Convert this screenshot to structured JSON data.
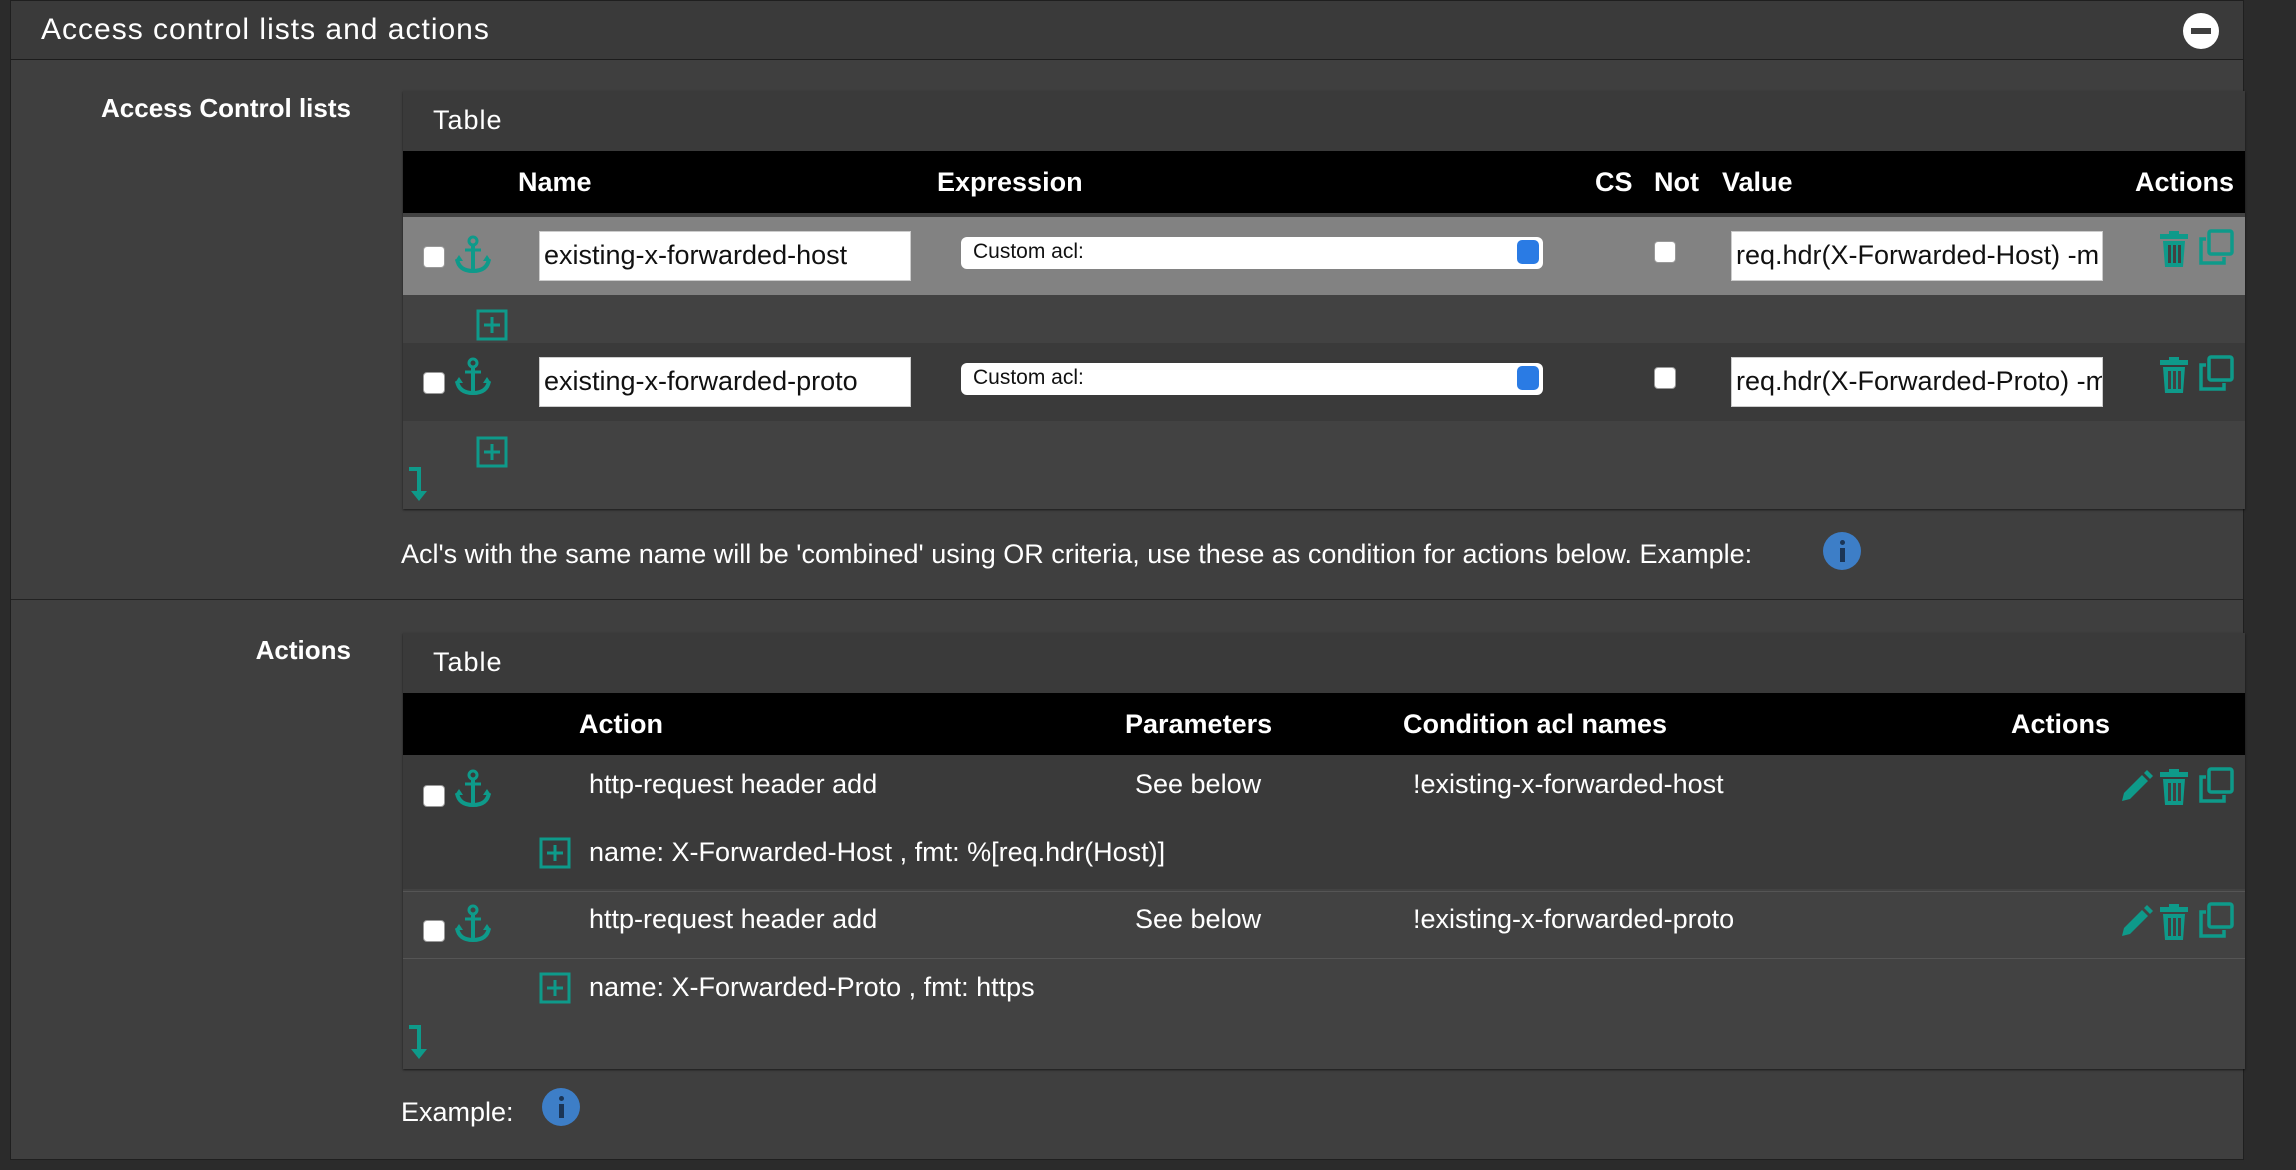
{
  "panel": {
    "title": "Access control lists and actions"
  },
  "acl": {
    "label": "Access Control lists",
    "table_caption": "Table",
    "columns": [
      "Name",
      "Expression",
      "CS",
      "Not",
      "Value",
      "Actions"
    ],
    "rows": [
      {
        "name": "existing-x-forwarded-host",
        "expression": "Custom acl:",
        "value": "req.hdr(X-Forwarded-Host) -m"
      },
      {
        "name": "existing-x-forwarded-proto",
        "expression": "Custom acl:",
        "value": "req.hdr(X-Forwarded-Proto) -m"
      }
    ],
    "note": "Acl's with the same name will be 'combined' using OR criteria, use these as condition for actions below. Example:"
  },
  "actions": {
    "label": "Actions",
    "table_caption": "Table",
    "columns": [
      "Action",
      "Parameters",
      "Condition acl names",
      "Actions"
    ],
    "rows": [
      {
        "action": "http-request header add",
        "parameters": "See below",
        "condition": "!existing-x-forwarded-host",
        "detail": "name: X-Forwarded-Host , fmt: %[req.hdr(Host)]"
      },
      {
        "action": "http-request header add",
        "parameters": "See below",
        "condition": "!existing-x-forwarded-proto",
        "detail": "name: X-Forwarded-Proto , fmt: https"
      }
    ],
    "note": "Example:"
  },
  "icons": {
    "anchor": "anchor-icon",
    "trash": "trash-icon",
    "copy": "copy-icon",
    "edit": "pencil-icon",
    "add": "plus-square-icon",
    "append": "arrow-down-icon",
    "info": "info-icon",
    "collapse": "minus-circle-icon"
  },
  "colors": {
    "accent": "#0e9a8a",
    "info": "#3d7ec7",
    "select_arrow": "#2a7be4"
  }
}
